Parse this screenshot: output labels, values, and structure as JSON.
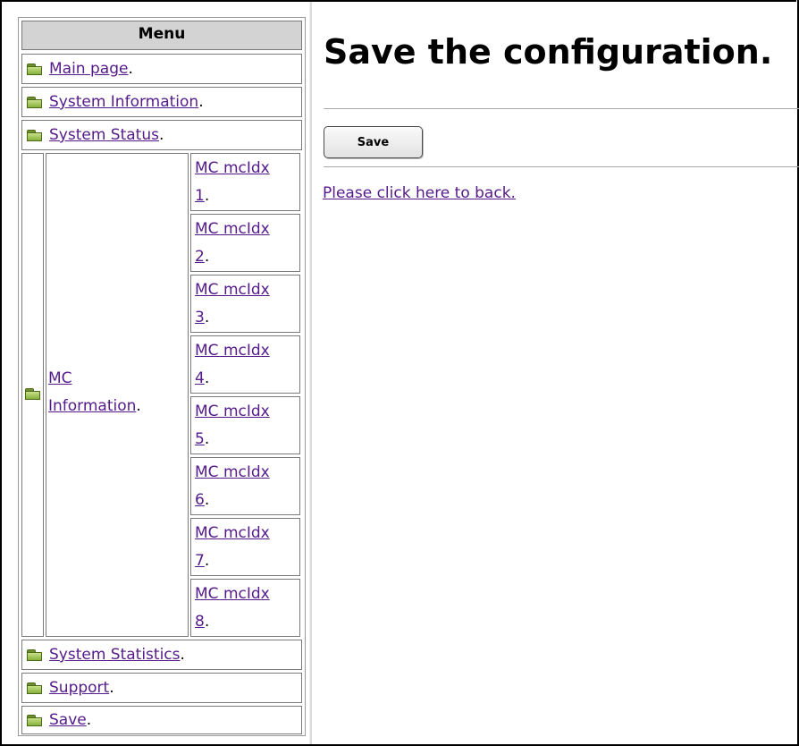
{
  "menu": {
    "header": "Menu",
    "items": [
      {
        "label": "Main page",
        "suffix": "."
      },
      {
        "label": "System Information",
        "suffix": "."
      },
      {
        "label": "System Status",
        "suffix": "."
      },
      {
        "label_line1": "MC",
        "label_line2": "Information",
        "suffix": "."
      },
      {
        "label": "System Statistics",
        "suffix": "."
      },
      {
        "label": "Support",
        "suffix": "."
      },
      {
        "label": "Save",
        "suffix": "."
      }
    ],
    "mc_sub": [
      {
        "line1": "MC mcIdx",
        "num": "1",
        "suffix": "."
      },
      {
        "line1": "MC mcIdx",
        "num": "2",
        "suffix": "."
      },
      {
        "line1": "MC mcIdx",
        "num": "3",
        "suffix": "."
      },
      {
        "line1": "MC mcIdx",
        "num": "4",
        "suffix": "."
      },
      {
        "line1": "MC mcIdx",
        "num": "5",
        "suffix": "."
      },
      {
        "line1": "MC mcIdx",
        "num": "6",
        "suffix": "."
      },
      {
        "line1": "MC mcIdx",
        "num": "7",
        "suffix": "."
      },
      {
        "line1": "MC mcIdx",
        "num": "8",
        "suffix": "."
      }
    ],
    "folder_icon": "folder-icon"
  },
  "main": {
    "title": "Save the configuration.",
    "save_button": "Save",
    "back_link": "Please click here to back."
  }
}
